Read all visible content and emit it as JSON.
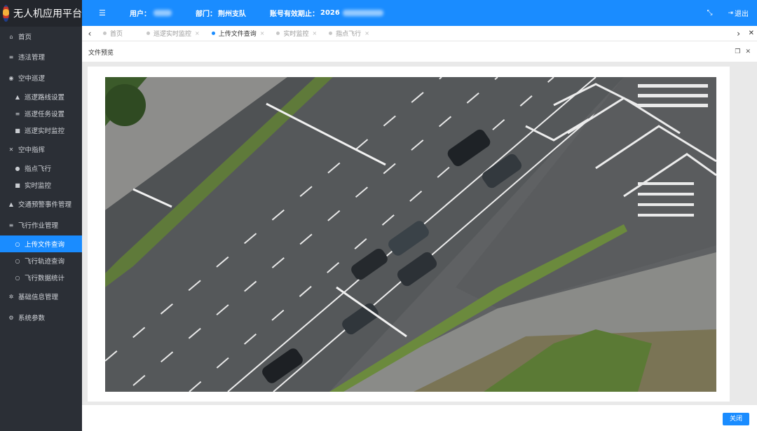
{
  "app": {
    "title": "无人机应用平台"
  },
  "topbar": {
    "user_label": "用户：",
    "dept_label": "部门：",
    "dept_value": "荆州支队",
    "expiry_label": "账号有效期止：",
    "expiry_value": "2026",
    "logout_label": "退出"
  },
  "sidebar": {
    "items": [
      {
        "label": "首页",
        "icon": "home-icon",
        "glyph": "⌂"
      },
      {
        "label": "违法管理",
        "icon": "list-icon",
        "glyph": "≡"
      },
      {
        "label": "空中巡逻",
        "icon": "eye-icon",
        "glyph": "◉"
      },
      {
        "label": "巡逻路线设置",
        "icon": "road-icon",
        "glyph": "▲"
      },
      {
        "label": "巡逻任务设置",
        "icon": "tasks-icon",
        "glyph": "≡"
      },
      {
        "label": "巡逻实时监控",
        "icon": "camera-icon",
        "glyph": "■"
      },
      {
        "label": "空中指挥",
        "icon": "drone-icon",
        "glyph": "✕"
      },
      {
        "label": "指点飞行",
        "icon": "target-icon",
        "glyph": "●"
      },
      {
        "label": "实时监控",
        "icon": "camera-icon",
        "glyph": "■"
      },
      {
        "label": "交通预警事件管理",
        "icon": "bell-icon",
        "glyph": "▲"
      },
      {
        "label": "飞行作业管理",
        "icon": "list-icon",
        "glyph": "≡"
      },
      {
        "label": "上传文件查询",
        "icon": "search-icon",
        "glyph": "○"
      },
      {
        "label": "飞行轨迹查询",
        "icon": "search-icon",
        "glyph": "○"
      },
      {
        "label": "飞行数据统计",
        "icon": "search-icon",
        "glyph": "○"
      },
      {
        "label": "基础信息管理",
        "icon": "gear-icon",
        "glyph": "✲"
      },
      {
        "label": "系统参数",
        "icon": "settings-icon",
        "glyph": "⚙"
      }
    ]
  },
  "tabs": [
    {
      "label": "首页",
      "closable": false,
      "active": false
    },
    {
      "label": "巡逻实时监控",
      "closable": true,
      "active": false
    },
    {
      "label": "上传文件查询",
      "closable": true,
      "active": true
    },
    {
      "label": "实时监控",
      "closable": true,
      "active": false
    },
    {
      "label": "指点飞行",
      "closable": true,
      "active": false
    }
  ],
  "panel": {
    "title": "文件预览",
    "close_button": "关闭"
  },
  "colors": {
    "accent": "#1a8cff",
    "sidebar_bg": "#2b2f36"
  }
}
